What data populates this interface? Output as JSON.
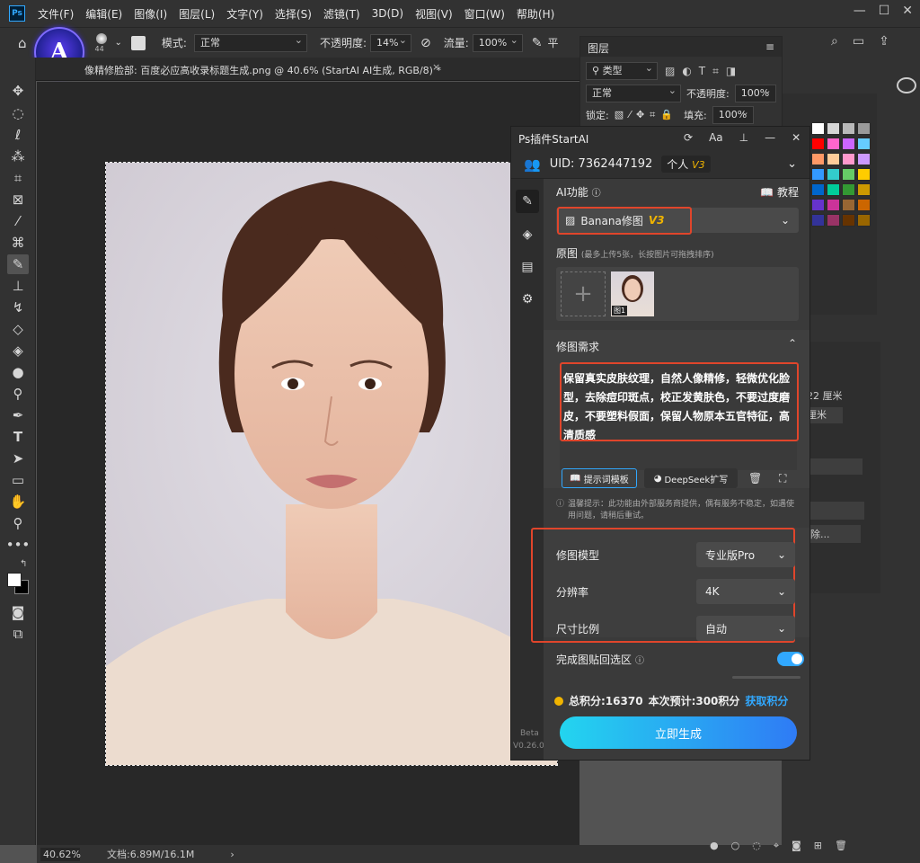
{
  "menu": {
    "logo": "Ps",
    "items": [
      "文件(F)",
      "编辑(E)",
      "图像(I)",
      "图层(L)",
      "文字(Y)",
      "选择(S)",
      "滤镜(T)",
      "3D(D)",
      "视图(V)",
      "窗口(W)",
      "帮助(H)"
    ]
  },
  "options": {
    "brush_size": "44",
    "mode_label": "模式:",
    "mode_value": "正常",
    "opacity_label": "不透明度:",
    "opacity_value": "14%",
    "flow_label": "流量:",
    "flow_value": "100%",
    "smooth_label": "平"
  },
  "doc_tab": {
    "title": "像精修脸部: 百度必应高收录标题生成.png @ 40.6% (StartAI AI生成, RGB/8) *",
    "close": "×"
  },
  "layers": {
    "title": "图层",
    "filter_label": "类型",
    "blend": "正常",
    "opacity_label": "不透明度:",
    "opacity_value": "100%",
    "lock_label": "锁定:",
    "fill_label": "填充:",
    "fill_value": "100%"
  },
  "props": {
    "w_value": "22 厘米",
    "h_value": "厘米",
    "btn_label": "除..."
  },
  "plugin": {
    "title": "Ps插件StartAI",
    "uid_label": "UID: 7362447192",
    "plan": "个人",
    "plan_ver": "V3",
    "ai_func_label": "AI功能",
    "tutorial": "教程",
    "func_name": "Banana修图",
    "func_ver": "V3",
    "orig_label": "原图",
    "orig_hint": "(最多上传5张，长按图片可拖拽排序)",
    "thumb_label": "图1",
    "req_label": "修图需求",
    "req_text": "保留真实皮肤纹理，自然人像精修，轻微优化脸型，去除痘印斑点，校正发黄肤色，不要过度磨皮，不要塑料假面，保留人物原本五官特征，高清质感",
    "prompt_tpl": "提示词模板",
    "deepseek": "DeepSeek扩写",
    "notice": "温馨提示：此功能由外部服务商提供，偶有服务不稳定，如遇使用问题，请稍后重试。",
    "settings": [
      {
        "label": "修图模型",
        "value": "专业版Pro"
      },
      {
        "label": "分辨率",
        "value": "4K"
      },
      {
        "label": "尺寸比例",
        "value": "自动"
      }
    ],
    "paste_label": "完成图贴回选区",
    "points": "总积分:16370",
    "cost": "本次预计:300积分",
    "get_points": "获取积分",
    "beta": "Beta",
    "version": "V0.26.0",
    "generate": "立即生成"
  },
  "status": {
    "zoom": "40.62%",
    "doc": "文档:6.89M/16.1M"
  },
  "colors": {
    "accent": "#31a8ff",
    "red_box": "#e0452b",
    "generate_start": "#23d5ef",
    "generate_end": "#2f7bf5",
    "v3": "#f0b400"
  }
}
